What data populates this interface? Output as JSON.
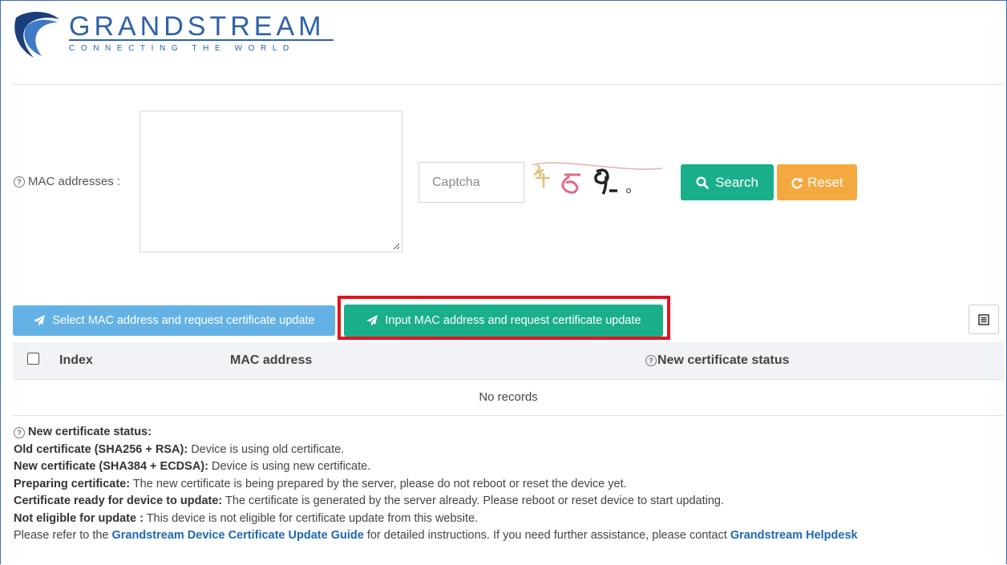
{
  "brand": {
    "name": "GRANDSTREAM",
    "tagline": "CONNECTING THE WORLD",
    "color": "#2e62a8"
  },
  "form": {
    "mac_label": "MAC addresses",
    "mac_colon": ":",
    "mac_value": "",
    "captcha_placeholder": "Captcha",
    "captcha_value": "",
    "search_label": "Search",
    "reset_label": "Reset"
  },
  "toolbar": {
    "select_label": "Select MAC address and request certificate update",
    "input_label": "Input MAC address and request certificate update"
  },
  "table": {
    "columns": [
      "Index",
      "MAC address",
      "New certificate status"
    ],
    "empty_text": "No records"
  },
  "notes": {
    "heading": "New certificate status:",
    "items": [
      {
        "term": "Old certificate (SHA256 + RSA):",
        "desc": " Device is using old certificate."
      },
      {
        "term": "New certificate (SHA384 + ECDSA):",
        "desc": " Device is using new certificate."
      },
      {
        "term": "Preparing certificate:",
        "desc": " The new certificate is being prepared by the server, please do not reboot or reset the device yet."
      },
      {
        "term": "Certificate ready for device to update:",
        "desc": " The certificate is generated by the server already. Please reboot or reset device to start updating."
      },
      {
        "term": "Not eligible for update :",
        "desc": " This device is not eligible for certificate update from this website."
      }
    ],
    "footer_prefix": "Please refer to the ",
    "guide_link": "Grandstream Device Certificate Update Guide",
    "footer_middle": " for detailed instructions. If you need further assistance, please contact ",
    "helpdesk_link": "Grandstream Helpdesk"
  },
  "colors": {
    "primary_green": "#1aaf8b",
    "reset_orange": "#f4a940",
    "select_blue": "#64b2e5",
    "highlight_red": "#e1141e",
    "link_blue": "#1e68b3"
  },
  "icons": {
    "search": "search-icon",
    "reset": "refresh-icon",
    "send": "paper-plane-icon",
    "columns": "list-columns-icon",
    "help": "question-circle-icon"
  }
}
